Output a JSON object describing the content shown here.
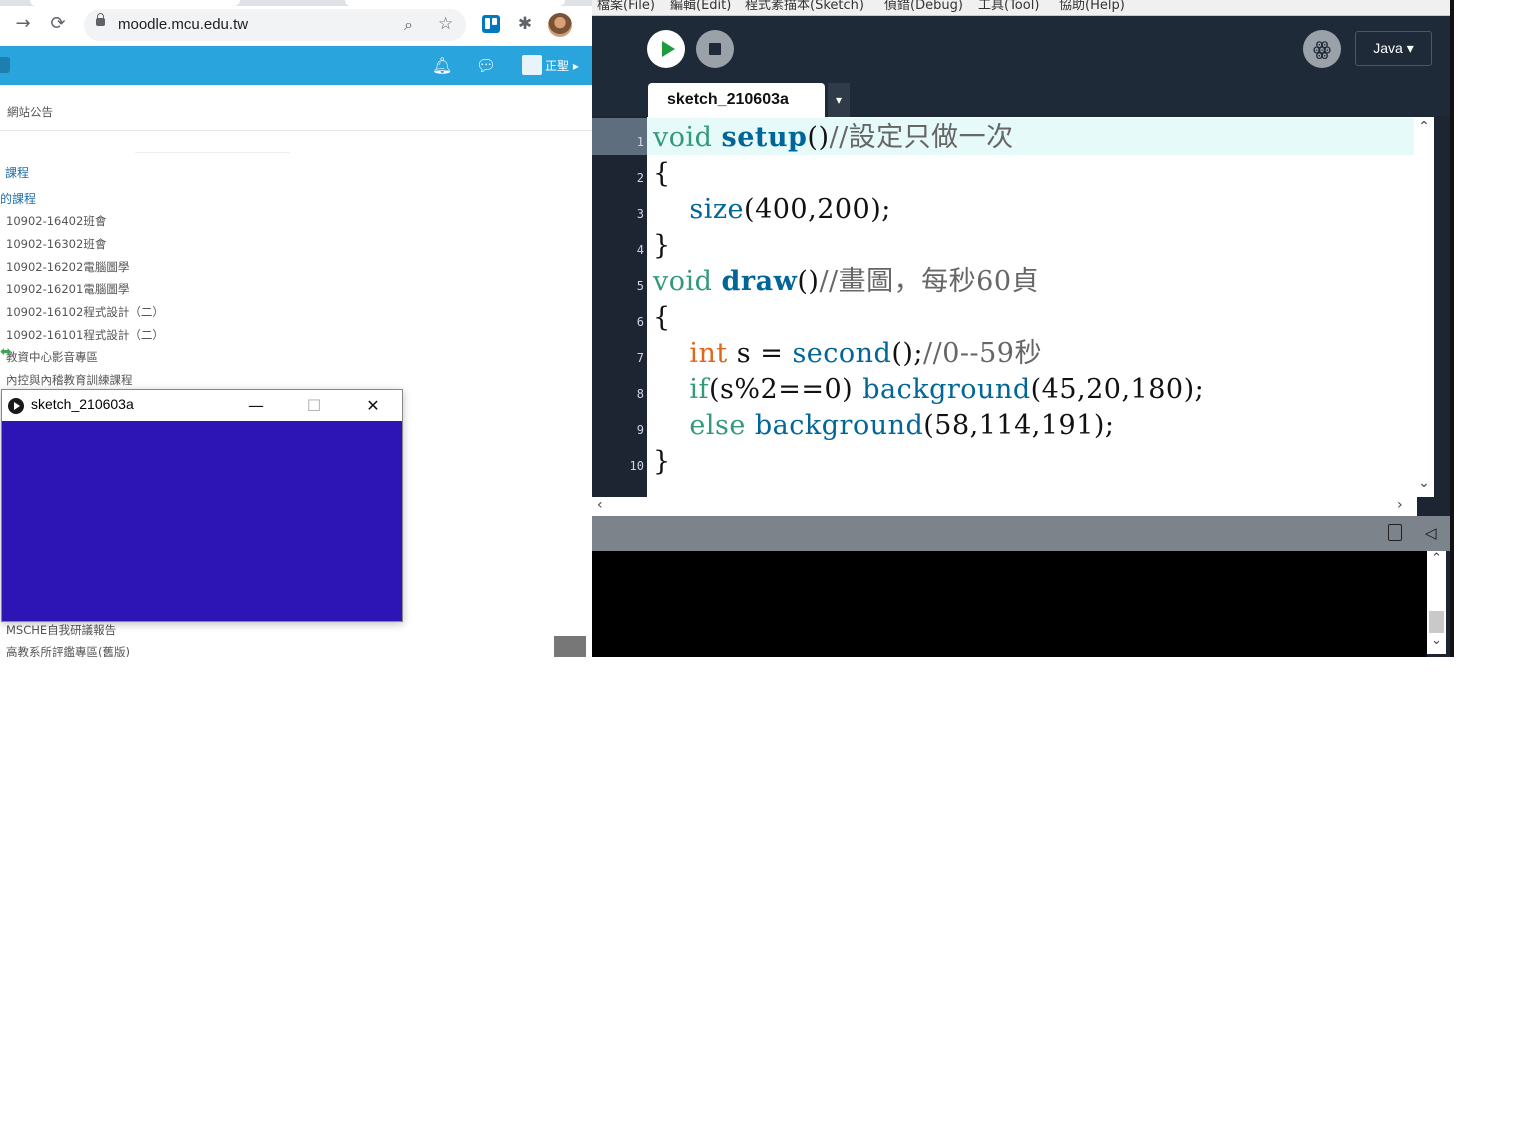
{
  "browser": {
    "url": "moodle.mcu.edu.tw",
    "nav": {
      "forward_icon": "forward-arrow-icon",
      "reload_icon": "reload-icon"
    },
    "moodle": {
      "user_name": "正聖",
      "site_announcements": "網站公告",
      "section_courses": "課程",
      "section_my_courses": "的課程",
      "courses": [
        "10902-16402班會",
        "10902-16302班會",
        "10902-16202電腦圖學",
        "10902-16201電腦圖學",
        "10902-16102程式設計（二）",
        "10902-16101程式設計（二）",
        "教資中心影音專區",
        "內控與內稽教育訓練課程"
      ],
      "bottom_items": [
        "MSCHE自我研議報告",
        "高教系所評鑑專區(舊版)"
      ]
    }
  },
  "sketch_window": {
    "title": "sketch_210603a",
    "minimize": "—",
    "maximize": "☐",
    "close": "✕",
    "canvas_color": "#2d14b4"
  },
  "ide": {
    "menus": [
      "檔案(File)",
      "編輯(Edit)",
      "程式素描本(Sketch)",
      "偵錯(Debug)",
      "工具(Tool)",
      "協助(Help)"
    ],
    "mode": "Java ▾",
    "tab_name": "sketch_210603a",
    "tab_menu": "▾",
    "colors": {
      "background": "#1e2a37",
      "run": "#1e9b3c",
      "keyword": "#33997e",
      "type": "#e2661a",
      "function": "#006699",
      "comment": "#666666"
    },
    "line_numbers": [
      "1",
      "2",
      "3",
      "4",
      "5",
      "6",
      "7",
      "8",
      "9",
      "10"
    ],
    "code": {
      "l1_kw": "void",
      "l1_fn": "setup",
      "l1_rest": "()",
      "l1_cm": "//設定只做一次",
      "l2": "{",
      "l3_fn": "size",
      "l3_rest": "(400,200);",
      "l4": "}",
      "l5_kw": "void",
      "l5_fn": "draw",
      "l5_rest": "()",
      "l5_cm": "//畫圖，每秒60貞",
      "l6": "{",
      "l7_ty": "int",
      "l7_mid": " s = ",
      "l7_fn": "second",
      "l7_rest": "();",
      "l7_cm": "//0--59秒",
      "l8_kw": "if",
      "l8_mid": "(s%2==0) ",
      "l8_fn": "background",
      "l8_rest": "(45,20,180);",
      "l9_kw": "else",
      "l9_fn": "background",
      "l9_rest": "(58,114,191);",
      "l10": "}"
    }
  }
}
